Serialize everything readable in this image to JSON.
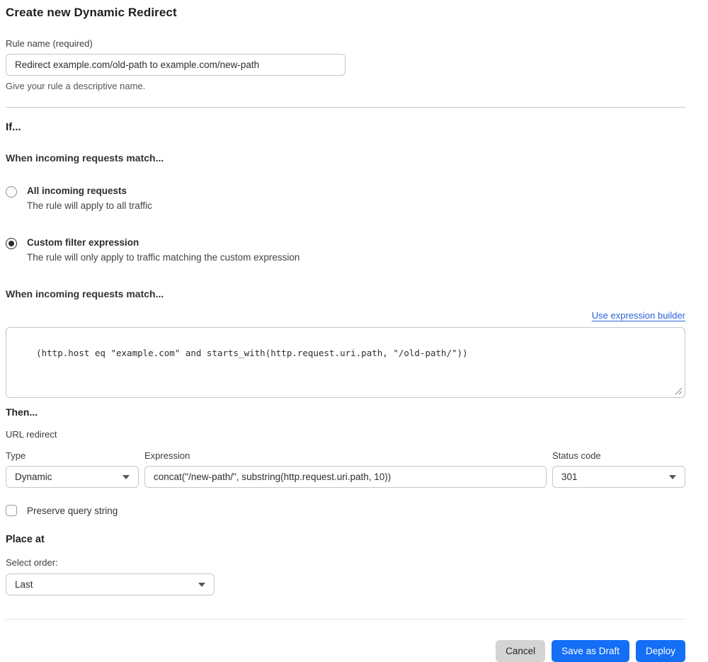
{
  "page": {
    "title": "Create new Dynamic Redirect"
  },
  "rule_name": {
    "label": "Rule name (required)",
    "value": "Redirect example.com/old-path to example.com/new-path",
    "help": "Give your rule a descriptive name."
  },
  "if_section": {
    "heading": "If...",
    "match_heading": "When incoming requests match...",
    "options": [
      {
        "label": "All incoming requests",
        "description": "The rule will apply to all traffic",
        "selected": false
      },
      {
        "label": "Custom filter expression",
        "description": "The rule will only apply to traffic matching the custom expression",
        "selected": true
      }
    ],
    "expression_heading": "When incoming requests match...",
    "builder_link": "Use expression builder",
    "expression_value": "(http.host eq \"example.com\" and starts_with(http.request.uri.path, \"/old-path/\"))"
  },
  "then_section": {
    "heading": "Then...",
    "subheading": "URL redirect",
    "type": {
      "label": "Type",
      "value": "Dynamic"
    },
    "expression": {
      "label": "Expression",
      "value": "concat(\"/new-path/\", substring(http.request.uri.path, 10))"
    },
    "status_code": {
      "label": "Status code",
      "value": "301"
    },
    "preserve_label": "Preserve query string"
  },
  "place_at": {
    "heading": "Place at",
    "label": "Select order:",
    "value": "Last"
  },
  "footer": {
    "cancel_label": "Cancel",
    "save_draft_label": "Save as Draft",
    "deploy_label": "Deploy"
  },
  "colors": {
    "primary_blue": "#146ef6",
    "link_blue": "#2962d9",
    "cancel_gray": "#d4d4d4",
    "border_gray": "#c6c6c6"
  }
}
